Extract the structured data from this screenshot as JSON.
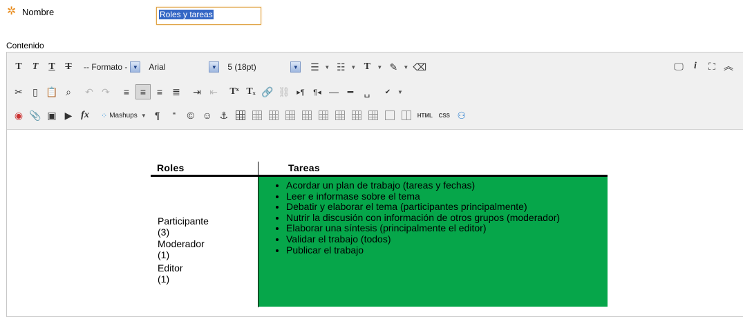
{
  "form": {
    "name_label": "Nombre",
    "name_value": "Roles y tareas",
    "content_label": "Contenido"
  },
  "toolbar": {
    "format_select": "-- Formato -",
    "font_select": "Arial",
    "size_select": "5 (18pt)",
    "mashups_label": "Mashups",
    "html_label": "HTML",
    "css_label": "CSS"
  },
  "table": {
    "header_roles": "Roles",
    "header_tasks": "Tareas",
    "roles": [
      "Participante (3)",
      "Moderador (1)",
      "Editor (1)"
    ],
    "tasks": [
      "Acordar un plan de trabajo (tareas y fechas)",
      "Leer e informase sobre el tema",
      "Debatir y elaborar el tema (participantes principalmente)",
      "Nutrir la discusión con información de otros grupos (moderador)",
      "Elaborar una síntesis (principalmente el editor)",
      "Validar el trabajo (todos)",
      "Publicar el trabajo"
    ],
    "tasks_bg_color": "#06a64a"
  },
  "colors": {
    "required_star": "#e88a1a",
    "selection_highlight": "#3467c5",
    "input_focus_border": "#e0a64a"
  }
}
